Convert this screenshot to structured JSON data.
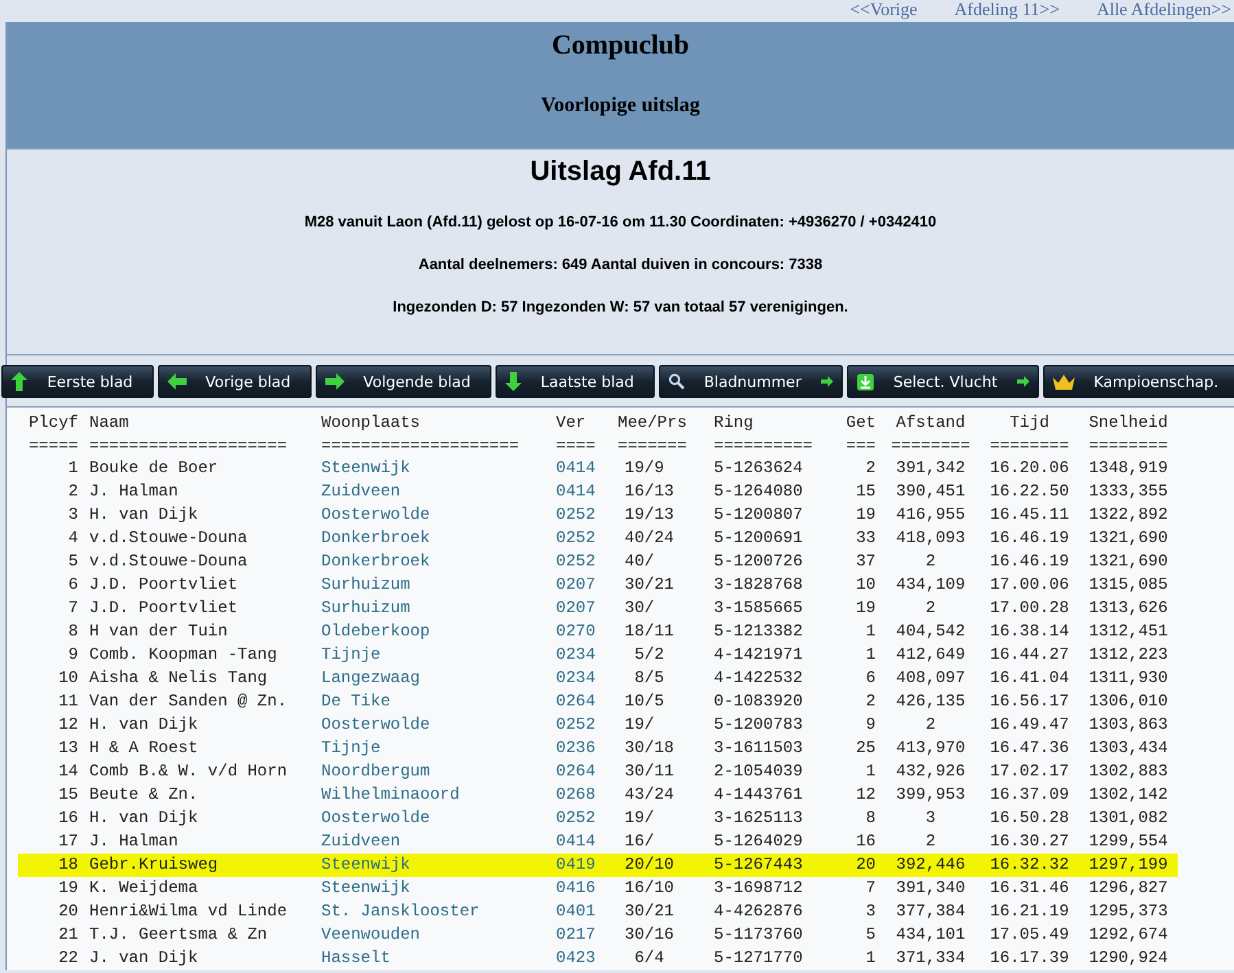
{
  "top_links": [
    "<<Vorige",
    "Afdeling 11>>",
    "Alle Afdelingen>>"
  ],
  "header": {
    "title": "Compuclub",
    "subtitle": "Voorlopige uitslag"
  },
  "summary": {
    "title": "Uitslag Afd.11",
    "lines": [
      "M28 vanuit Laon (Afd.11) gelost op 16-07-16 om 11.30 Coordinaten: +4936270 / +0342410",
      "Aantal deelnemers: 649 Aantal duiven in concours: 7338",
      "Ingezonden D: 57 Ingezonden W: 57 van totaal 57 verenigingen."
    ]
  },
  "buttons": [
    {
      "label": "Eerste blad",
      "kind": "up",
      "trailing_arrow": false
    },
    {
      "label": "Vorige blad",
      "kind": "left",
      "trailing_arrow": false
    },
    {
      "label": "Volgende blad",
      "kind": "right",
      "trailing_arrow": false
    },
    {
      "label": "Laatste blad",
      "kind": "down",
      "trailing_arrow": false
    },
    {
      "label": "Bladnummer",
      "kind": "search",
      "trailing_arrow": true
    },
    {
      "label": "Select. Vlucht",
      "kind": "select",
      "trailing_arrow": true
    },
    {
      "label": "Kampioenschap.",
      "kind": "crown",
      "trailing_arrow": false
    }
  ],
  "table": {
    "columns": [
      "Plcyf",
      "Naam",
      "Woonplaats",
      "Ver",
      "Mee/Prs",
      "Ring",
      "Get",
      "Afstand",
      "Tijd",
      "Snelheid"
    ],
    "separators": [
      "=====",
      "====================",
      "====================",
      "====",
      "=======",
      "==========",
      "===",
      "========",
      "========",
      "========"
    ],
    "rows": [
      {
        "cells": [
          "1",
          "Bouke de Boer",
          "Steenwijk",
          "0414",
          "19/9",
          "5-1263624",
          "2",
          "391,342",
          "16.20.06",
          "1348,919"
        ],
        "highlighted": false
      },
      {
        "cells": [
          "2",
          "J. Halman",
          "Zuidveen",
          "0414",
          "16/13",
          "5-1264080",
          "15",
          "390,451",
          "16.22.50",
          "1333,355"
        ],
        "highlighted": false
      },
      {
        "cells": [
          "3",
          "H. van Dijk",
          "Oosterwolde",
          "0252",
          "19/13",
          "5-1200807",
          "19",
          "416,955",
          "16.45.11",
          "1322,892"
        ],
        "highlighted": false
      },
      {
        "cells": [
          "4",
          "v.d.Stouwe-Douna",
          "Donkerbroek",
          "0252",
          "40/24",
          "5-1200691",
          "33",
          "418,093",
          "16.46.19",
          "1321,690"
        ],
        "highlighted": false
      },
      {
        "cells": [
          "5",
          "v.d.Stouwe-Douna",
          "Donkerbroek",
          "0252",
          "40/",
          "5-1200726",
          "37",
          "2",
          "16.46.19",
          "1321,690"
        ],
        "highlighted": false
      },
      {
        "cells": [
          "6",
          "J.D. Poortvliet",
          "Surhuizum",
          "0207",
          "30/21",
          "3-1828768",
          "10",
          "434,109",
          "17.00.06",
          "1315,085"
        ],
        "highlighted": false
      },
      {
        "cells": [
          "7",
          "J.D. Poortvliet",
          "Surhuizum",
          "0207",
          "30/",
          "3-1585665",
          "19",
          "2",
          "17.00.28",
          "1313,626"
        ],
        "highlighted": false
      },
      {
        "cells": [
          "8",
          "H van der Tuin",
          "Oldeberkoop",
          "0270",
          "18/11",
          "5-1213382",
          "1",
          "404,542",
          "16.38.14",
          "1312,451"
        ],
        "highlighted": false
      },
      {
        "cells": [
          "9",
          "Comb. Koopman -Tang",
          "Tijnje",
          "0234",
          "5/2",
          "4-1421971",
          "1",
          "412,649",
          "16.44.27",
          "1312,223"
        ],
        "highlighted": false
      },
      {
        "cells": [
          "10",
          "Aisha & Nelis Tang",
          "Langezwaag",
          "0234",
          "8/5",
          "4-1422532",
          "6",
          "408,097",
          "16.41.04",
          "1311,930"
        ],
        "highlighted": false
      },
      {
        "cells": [
          "11",
          "Van der Sanden @ Zn.",
          "De Tike",
          "0264",
          "10/5",
          "0-1083920",
          "2",
          "426,135",
          "16.56.17",
          "1306,010"
        ],
        "highlighted": false
      },
      {
        "cells": [
          "12",
          "H. van Dijk",
          "Oosterwolde",
          "0252",
          "19/",
          "5-1200783",
          "9",
          "2",
          "16.49.47",
          "1303,863"
        ],
        "highlighted": false
      },
      {
        "cells": [
          "13",
          "H & A Roest",
          "Tijnje",
          "0236",
          "30/18",
          "3-1611503",
          "25",
          "413,970",
          "16.47.36",
          "1303,434"
        ],
        "highlighted": false
      },
      {
        "cells": [
          "14",
          "Comb B.& W. v/d Horn",
          "Noordbergum",
          "0264",
          "30/11",
          "2-1054039",
          "1",
          "432,926",
          "17.02.17",
          "1302,883"
        ],
        "highlighted": false
      },
      {
        "cells": [
          "15",
          "Beute & Zn.",
          "Wilhelminaoord",
          "0268",
          "43/24",
          "4-1443761",
          "12",
          "399,953",
          "16.37.09",
          "1302,142"
        ],
        "highlighted": false
      },
      {
        "cells": [
          "16",
          "H. van Dijk",
          "Oosterwolde",
          "0252",
          "19/",
          "3-1625113",
          "8",
          "3",
          "16.50.28",
          "1301,082"
        ],
        "highlighted": false
      },
      {
        "cells": [
          "17",
          "J. Halman",
          "Zuidveen",
          "0414",
          "16/",
          "5-1264029",
          "16",
          "2",
          "16.30.27",
          "1299,554"
        ],
        "highlighted": false
      },
      {
        "cells": [
          "18",
          "Gebr.Kruisweg",
          "Steenwijk",
          "0419",
          "20/10",
          "5-1267443",
          "20",
          "392,446",
          "16.32.32",
          "1297,199"
        ],
        "highlighted": true
      },
      {
        "cells": [
          "19",
          "K. Weijdema",
          "Steenwijk",
          "0416",
          "16/10",
          "3-1698712",
          "7",
          "391,340",
          "16.31.46",
          "1296,827"
        ],
        "highlighted": false
      },
      {
        "cells": [
          "20",
          "Henri&Wilma vd Linde",
          "St. Jansklooster",
          "0401",
          "30/21",
          "4-4262876",
          "3",
          "377,384",
          "16.21.19",
          "1295,373"
        ],
        "highlighted": false
      },
      {
        "cells": [
          "21",
          "T.J. Geertsma & Zn",
          "Veenwouden",
          "0217",
          "30/16",
          "5-1173760",
          "5",
          "434,101",
          "17.05.49",
          "1292,674"
        ],
        "highlighted": false
      },
      {
        "cells": [
          "22",
          "J. van Dijk",
          "Hasselt",
          "0423",
          "6/4",
          "5-1271770",
          "1",
          "371,334",
          "16.17.39",
          "1290,924"
        ],
        "highlighted": false
      }
    ]
  }
}
